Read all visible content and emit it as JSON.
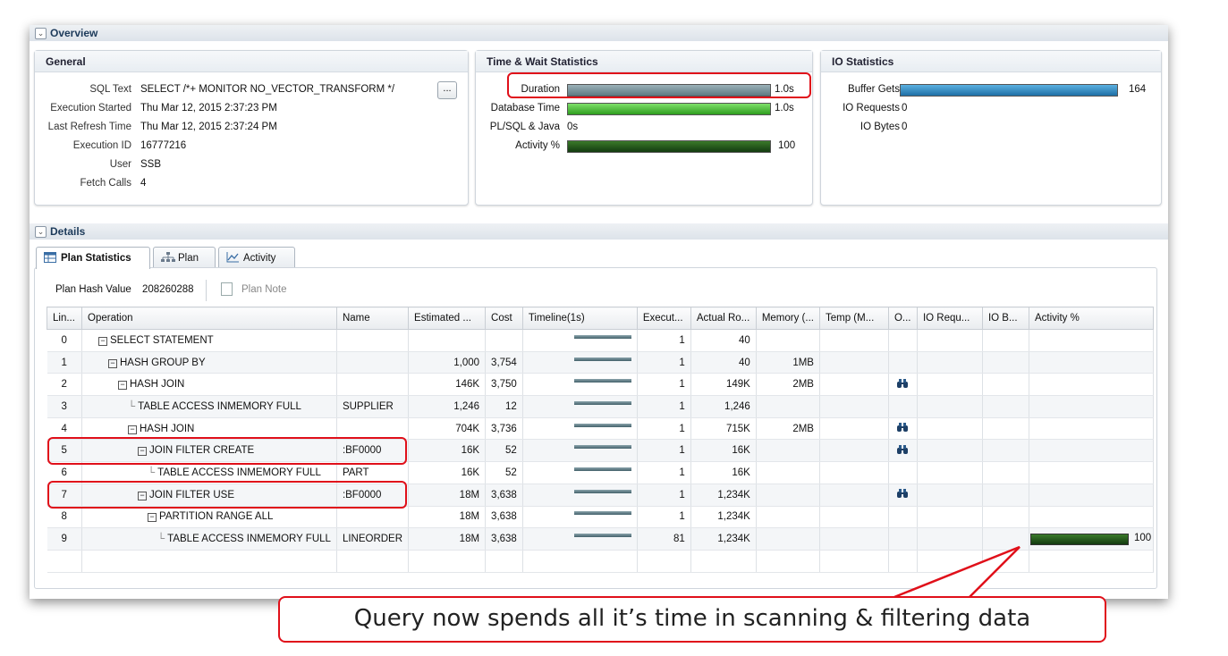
{
  "overview": {
    "title": "Overview",
    "general": {
      "title": "General",
      "fields": [
        {
          "label": "SQL Text",
          "value": "SELECT /*+ MONITOR NO_VECTOR_TRANSFORM */"
        },
        {
          "label": "Execution Started",
          "value": "Thu Mar 12, 2015 2:37:23 PM"
        },
        {
          "label": "Last Refresh Time",
          "value": "Thu Mar 12, 2015 2:37:24 PM"
        },
        {
          "label": "Execution ID",
          "value": "16777216"
        },
        {
          "label": "User",
          "value": "SSB"
        },
        {
          "label": "Fetch Calls",
          "value": "4"
        }
      ],
      "more_button": "..."
    },
    "time_wait": {
      "title": "Time & Wait Statistics",
      "rows": [
        {
          "label": "Duration",
          "value": "1.0s",
          "fraction": 1.0
        },
        {
          "label": "Database Time",
          "value": "1.0s",
          "fraction": 1.0
        },
        {
          "label": "PL/SQL & Java",
          "value": "0s",
          "fraction": 0
        },
        {
          "label": "Activity %",
          "value": "100",
          "fraction": 1.0
        }
      ]
    },
    "io": {
      "title": "IO Statistics",
      "rows": [
        {
          "label": "Buffer Gets",
          "value": "164",
          "fraction": 1.0
        },
        {
          "label": "IO Requests",
          "value": "0",
          "fraction": 0
        },
        {
          "label": "IO Bytes",
          "value": "0",
          "fraction": 0
        }
      ]
    }
  },
  "details": {
    "title": "Details",
    "tabs": [
      {
        "label": "Plan Statistics",
        "icon": "table-icon",
        "selected": true
      },
      {
        "label": "Plan",
        "icon": "tree-icon",
        "selected": false
      },
      {
        "label": "Activity",
        "icon": "chart-icon",
        "selected": false
      }
    ],
    "plan_hash_label": "Plan Hash Value",
    "plan_hash_value": "208260288",
    "plan_note_label": "Plan Note",
    "columns": [
      "Lin...",
      "Operation",
      "Name",
      "Estimated ...",
      "Cost",
      "Timeline(1s)",
      "Execut...",
      "Actual Ro...",
      "Memory (...",
      "Temp (M...",
      "O...",
      "IO Requ...",
      "IO B...",
      "Activity %"
    ],
    "rows": [
      {
        "line": "0",
        "indent": 0,
        "op": "SELECT STATEMENT",
        "expand": true,
        "name": "",
        "est": "",
        "cost": "",
        "exec": "1",
        "actual": "40",
        "mem": "",
        "temp": "",
        "o": false,
        "activity": "",
        "activity_fraction": 0
      },
      {
        "line": "1",
        "indent": 1,
        "op": "HASH GROUP BY",
        "expand": true,
        "name": "",
        "est": "1,000",
        "cost": "3,754",
        "exec": "1",
        "actual": "40",
        "mem": "1MB",
        "temp": "",
        "o": false,
        "activity": "",
        "activity_fraction": 0
      },
      {
        "line": "2",
        "indent": 2,
        "op": "HASH JOIN",
        "expand": true,
        "name": "",
        "est": "146K",
        "cost": "3,750",
        "exec": "1",
        "actual": "149K",
        "mem": "2MB",
        "temp": "",
        "o": true,
        "activity": "",
        "activity_fraction": 0
      },
      {
        "line": "3",
        "indent": 3,
        "op": "TABLE ACCESS INMEMORY FULL",
        "expand": false,
        "name": "SUPPLIER",
        "est": "1,246",
        "cost": "12",
        "exec": "1",
        "actual": "1,246",
        "mem": "",
        "temp": "",
        "o": false,
        "activity": "",
        "activity_fraction": 0
      },
      {
        "line": "4",
        "indent": 3,
        "op": "HASH JOIN",
        "expand": true,
        "name": "",
        "est": "704K",
        "cost": "3,736",
        "exec": "1",
        "actual": "715K",
        "mem": "2MB",
        "temp": "",
        "o": true,
        "activity": "",
        "activity_fraction": 0
      },
      {
        "line": "5",
        "indent": 4,
        "op": "JOIN FILTER CREATE",
        "expand": true,
        "name": ":BF0000",
        "est": "16K",
        "cost": "52",
        "exec": "1",
        "actual": "16K",
        "mem": "",
        "temp": "",
        "o": true,
        "activity": "",
        "activity_fraction": 0
      },
      {
        "line": "6",
        "indent": 5,
        "op": "TABLE ACCESS INMEMORY FULL",
        "expand": false,
        "name": "PART",
        "est": "16K",
        "cost": "52",
        "exec": "1",
        "actual": "16K",
        "mem": "",
        "temp": "",
        "o": false,
        "activity": "",
        "activity_fraction": 0
      },
      {
        "line": "7",
        "indent": 4,
        "op": "JOIN FILTER USE",
        "expand": true,
        "name": ":BF0000",
        "est": "18M",
        "cost": "3,638",
        "exec": "1",
        "actual": "1,234K",
        "mem": "",
        "temp": "",
        "o": true,
        "activity": "",
        "activity_fraction": 0
      },
      {
        "line": "8",
        "indent": 5,
        "op": "PARTITION RANGE ALL",
        "expand": true,
        "name": "",
        "est": "18M",
        "cost": "3,638",
        "exec": "1",
        "actual": "1,234K",
        "mem": "",
        "temp": "",
        "o": false,
        "activity": "",
        "activity_fraction": 0
      },
      {
        "line": "9",
        "indent": 6,
        "op": "TABLE ACCESS INMEMORY FULL",
        "expand": false,
        "name": "LINEORDER",
        "est": "18M",
        "cost": "3,638",
        "exec": "81",
        "actual": "1,234K",
        "mem": "",
        "temp": "",
        "o": false,
        "activity": "100",
        "activity_fraction": 1.0
      }
    ]
  },
  "callout": {
    "text": "Query now spends all it’s time in scanning & filtering data"
  },
  "colors": {
    "highlight": "#e0101a",
    "header_text": "#1c3a5a"
  }
}
